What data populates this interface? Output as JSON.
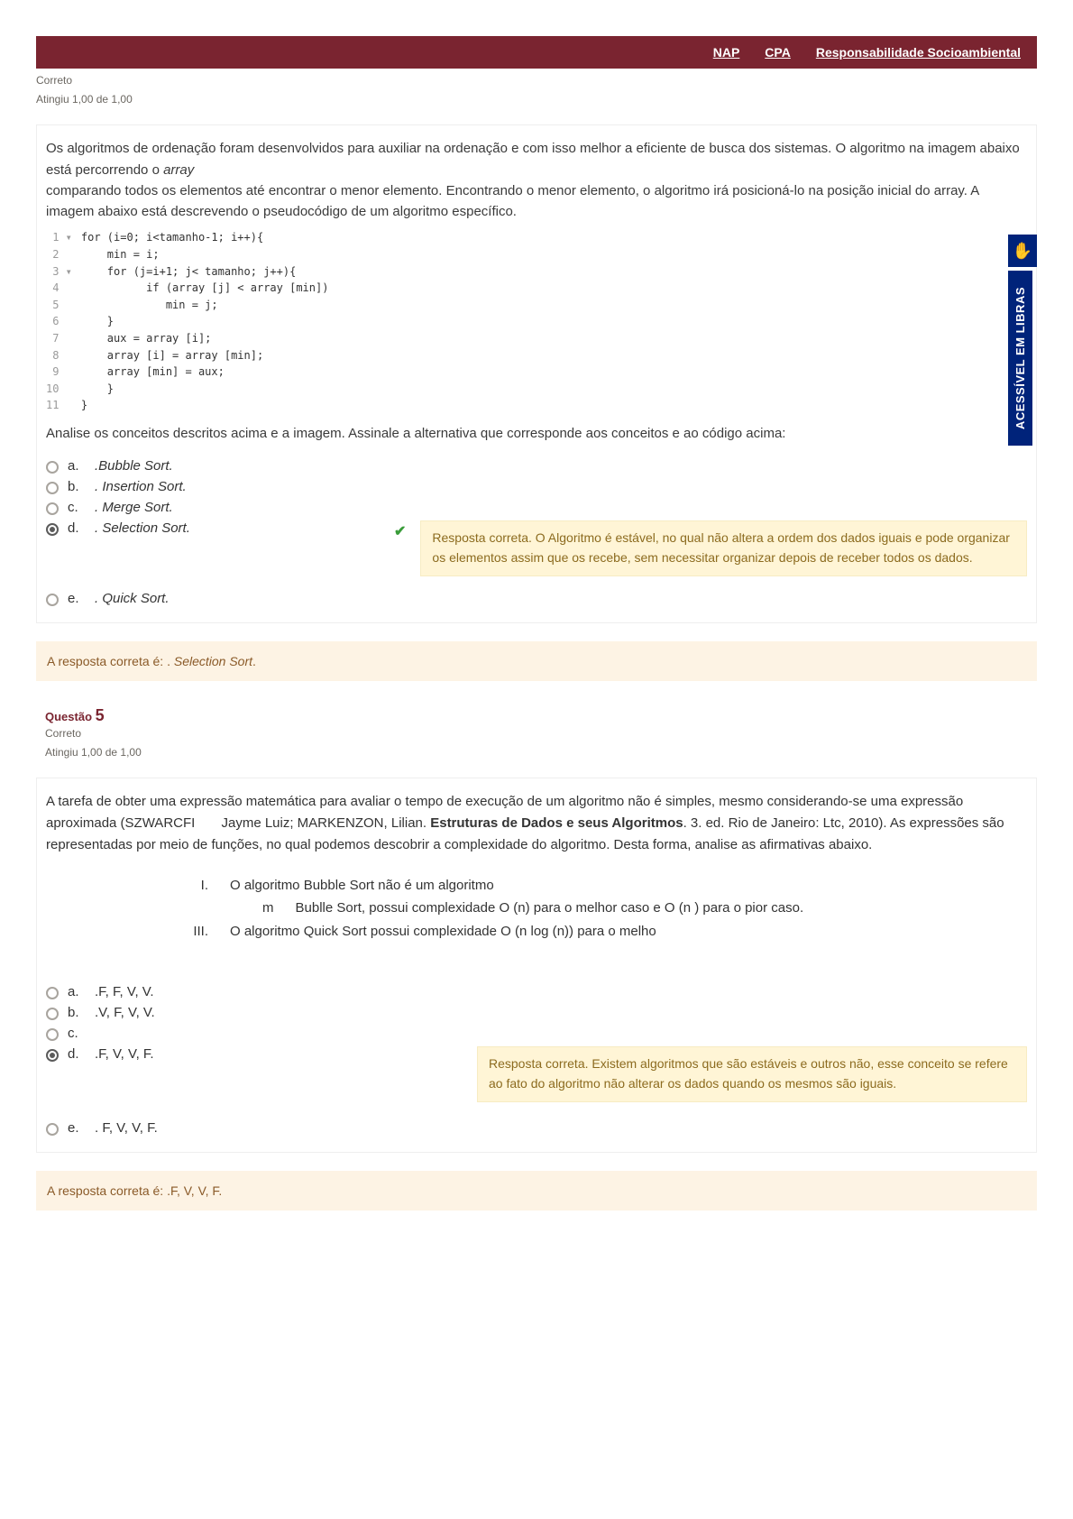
{
  "topbar": {
    "links": [
      "NAP",
      "CPA",
      "Responsabilidade Socioambiental"
    ]
  },
  "libras": {
    "label": "ACESSÍVEL EM LIBRAS",
    "icon": "✋"
  },
  "q4": {
    "status1": "Correto",
    "status2": "Atingiu 1,00 de 1,00",
    "intro1": "Os algoritmos de ordenação foram desenvolvidos para auxiliar na ordenação e com isso melhor a eficiente de busca dos sistemas. O algoritmo na imagem abaixo está percorrendo o ",
    "intro1_ital": "array",
    "intro2": "comparando todos os elementos até encontrar o menor elemento. Encontrando o menor elemento, o algoritmo irá posicioná-lo na posição inicial do array. A imagem abaixo está descrevendo o pseudocódigo de um algoritmo específico.",
    "code_ln": " 1 ▾\n 2  \n 3 ▾\n 4  \n 5  \n 6  \n 7  \n 8  \n 9  \n10  \n11  ",
    "code": "for (i=0; i<tamanho-1; i++){\n    min = i;\n    for (j=i+1; j< tamanho; j++){\n          if (array [j] < array [min])\n             min = j;\n    }\n    aux = array [i];\n    array [i] = array [min];\n    array [min] = aux;\n    }\n}",
    "post": "Analise os conceitos descritos acima e a imagem. Assinale a alternativa que corresponde aos conceitos e ao código acima:",
    "options": [
      {
        "letter": "a.",
        "text": ".Bubble Sort.",
        "selected": false
      },
      {
        "letter": "b.",
        "text": ". Insertion Sort.",
        "selected": false
      },
      {
        "letter": "c.",
        "text": ". Merge Sort.",
        "selected": false
      },
      {
        "letter": "d.",
        "text": ". Selection Sort.",
        "selected": true
      },
      {
        "letter": "e.",
        "text": ". Quick Sort.",
        "selected": false
      }
    ],
    "feedback": "Resposta correta. O Algoritmo é estável, no qual não altera a ordem dos dados iguais e pode organizar os elementos assim que os recebe, sem necessitar organizar depois de receber todos os dados.",
    "answer_prefix": "A resposta correta é: . ",
    "answer_em": "Selection Sort",
    "answer_suffix": "."
  },
  "q5": {
    "tag1": "Questão ",
    "tag2": "5",
    "status1": "Correto",
    "status2": "Atingiu 1,00 de 1,00",
    "intro": "A tarefa de obter uma expressão matemática para avaliar o tempo de execução de um algoritmo não é simples, mesmo considerando-se uma expressão aproximada (SZWARCFI       Jayme Luiz; MARKENZON, Lilian. Estruturas de Dados e seus Algoritmos. 3. ed. Rio de Janeiro: Ltc, 2010). As expressões são representadas por meio de funções, no qual podemos descobrir a complexidade do algoritmo. Desta forma, analise as afirmativas abaixo.",
    "intro_bold": "Estruturas de Dados e seus Algoritmos",
    "afirm1_rn": "I.",
    "afirm1_txt": "O algoritmo Bubble Sort não é um algoritmo",
    "afirm2_rn": "m",
    "afirm2_txt": "Bublle Sort, possui complexidade O (n) para o melhor caso e O (n ) para o pior caso.",
    "afirm3_rn": "III.",
    "afirm3_txt": "O algoritmo Quick Sort possui complexidade O (n log (n)) para o melho",
    "options": [
      {
        "letter": "a.",
        "text": ".F, F, V, V.",
        "selected": false
      },
      {
        "letter": "b.",
        "text": ".V, F, V, V.",
        "selected": false
      },
      {
        "letter": "c.",
        "text": "",
        "selected": false
      },
      {
        "letter": "d.",
        "text": ".F, V, V, F.",
        "selected": true
      },
      {
        "letter": "e.",
        "text": ". F, V, V, F.",
        "selected": false
      }
    ],
    "feedback": "Resposta correta. Existem algoritmos que são estáveis e outros não, esse conceito se refere ao fato do algoritmo não alterar os dados quando os mesmos são iguais.",
    "answer": "A resposta correta é: .F, V, V, F."
  }
}
